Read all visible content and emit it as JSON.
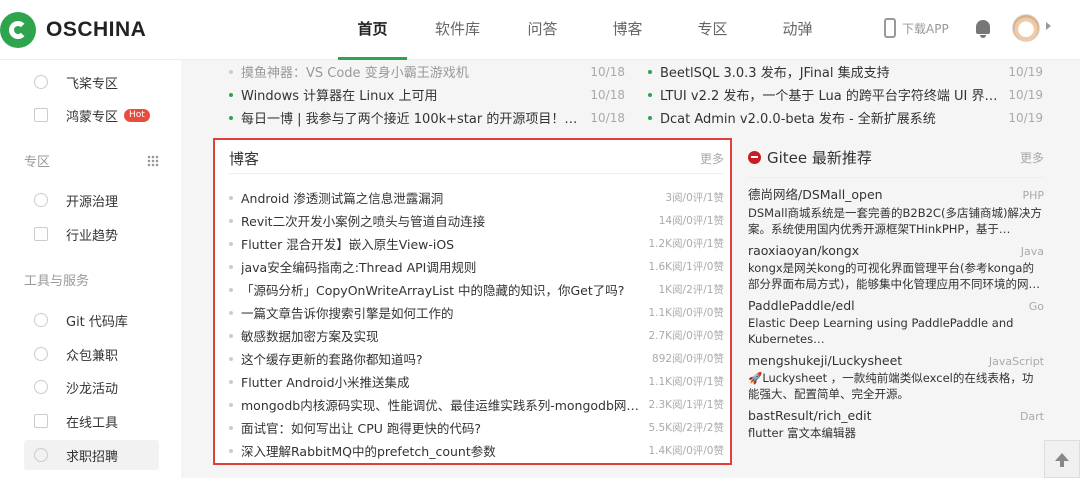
{
  "header": {
    "logo_text": "OSCHINA",
    "nav": [
      "首页",
      "软件库",
      "问答",
      "博客",
      "专区",
      "动弹"
    ],
    "download_label": "下载APP"
  },
  "sidebar": {
    "items_top": [
      {
        "label": "飞桨专区"
      },
      {
        "label": "鸿蒙专区",
        "badge": "Hot"
      }
    ],
    "section_zone": "专区",
    "zone_items": [
      "开源治理",
      "行业趋势"
    ],
    "section_tools": "工具与服务",
    "tool_items": [
      "Git 代码库",
      "众包兼职",
      "沙龙活动",
      "在线工具",
      "求职招聘"
    ]
  },
  "news_left": [
    {
      "title": "摸鱼神器：VS Code 变身小霸王游戏机",
      "date": "10/18"
    },
    {
      "title": "Windows 计算器在 Linux 上可用",
      "date": "10/18"
    },
    {
      "title": "每日一博 | 我参与了两个接近 100k+star 的开源项目！聊聊…",
      "date": "10/18"
    }
  ],
  "news_right": [
    {
      "title": "BeetlSQL 3.0.3 发布，JFinal 集成支持",
      "date": "10/19"
    },
    {
      "title": "LTUI v2.2 发布，一个基于 Lua 的跨平台字符终端 UI 界面库",
      "date": "10/19"
    },
    {
      "title": "Dcat Admin v2.0.0-beta 发布 - 全新扩展系统",
      "date": "10/19"
    }
  ],
  "blog": {
    "title": "博客",
    "more": "更多",
    "items": [
      {
        "title": "Android 渗透测试篇之信息泄露漏洞",
        "stats": "3阅/0评/1赞"
      },
      {
        "title": "Revit二次开发小案例之喷头与管道自动连接",
        "stats": "14阅/0评/1赞"
      },
      {
        "title": "Flutter 混合开发】嵌入原生View-iOS",
        "stats": "1.2K阅/0评/1赞"
      },
      {
        "title": "java安全编码指南之:Thread API调用规则",
        "stats": "1.6K阅/1评/0赞"
      },
      {
        "title": "「源码分析」CopyOnWriteArrayList 中的隐藏的知识，你Get了吗?",
        "stats": "1K阅/2评/1赞"
      },
      {
        "title": "一篇文章告诉你搜索引擎是如何工作的",
        "stats": "1.1K阅/0评/0赞"
      },
      {
        "title": "敏感数据加密方案及实现",
        "stats": "2.7K阅/0评/0赞"
      },
      {
        "title": "这个缓存更新的套路你都知道吗?",
        "stats": "892阅/0评/0赞"
      },
      {
        "title": "Flutter Android小米推送集成",
        "stats": "1.1K阅/0评/1赞"
      },
      {
        "title": "mongodb内核源码实现、性能调优、最佳运维实践系列-mongodb网…",
        "stats": "2.3K阅/1评/1赞"
      },
      {
        "title": "面试官：如何写出让 CPU 跑得更快的代码?",
        "stats": "5.5K阅/2评/2赞"
      },
      {
        "title": "深入理解RabbitMQ中的prefetch_count参数",
        "stats": "1.4K阅/0评/0赞"
      }
    ]
  },
  "gitee": {
    "title": "Gitee 最新推荐",
    "more": "更多",
    "repos": [
      {
        "name": "德尚网络/DSMall_open",
        "lang": "PHP",
        "desc": "DSMall商城系统是一套完善的B2B2C(多店铺商城)解决方案。系统使用国内优秀开源框架THinkPHP，基于…"
      },
      {
        "name": "raoxiaoyan/kongx",
        "lang": "Java",
        "desc": "kongx是网关kong的可视化界面管理平台(参考konga的部分界面布局方式)，能够集中化管理应用不同环境的网…"
      },
      {
        "name": "PaddlePaddle/edl",
        "lang": "Go",
        "desc": "Elastic Deep Learning using PaddlePaddle and Kubernetes…"
      },
      {
        "name": "mengshukeji/Luckysheet",
        "lang": "JavaScript",
        "desc": "🚀Luckysheet ，一款纯前端类似excel的在线表格，功能强大、配置简单、完全开源。"
      },
      {
        "name": "bastResult/rich_edit",
        "lang": "Dart",
        "desc": "flutter 富文本编辑器"
      }
    ]
  },
  "colors": {
    "accent": "#2ea44f",
    "highlight_border": "#e0403a",
    "gitee": "#c71d23"
  }
}
